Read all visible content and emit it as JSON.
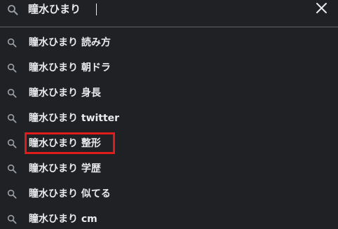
{
  "search": {
    "query": "瞳水ひまり",
    "clear_icon": "close-icon",
    "search_icon": "search-icon"
  },
  "suggestions": [
    {
      "label": "瞳水ひまり 読み方"
    },
    {
      "label": "瞳水ひまり 朝ドラ"
    },
    {
      "label": "瞳水ひまり 身長"
    },
    {
      "label": "瞳水ひまり twitter"
    },
    {
      "label": "瞳水ひまり 整形"
    },
    {
      "label": "瞳水ひまり 学歴"
    },
    {
      "label": "瞳水ひまり 似てる"
    },
    {
      "label": "瞳水ひまり cm"
    }
  ],
  "highlight": {
    "color": "#e01b1b",
    "target": "瞳水ひまり 整形"
  },
  "colors": {
    "background": "#202124",
    "text": "#e8eaed",
    "icon": "#9aa0a6",
    "divider": "#5f6368"
  }
}
